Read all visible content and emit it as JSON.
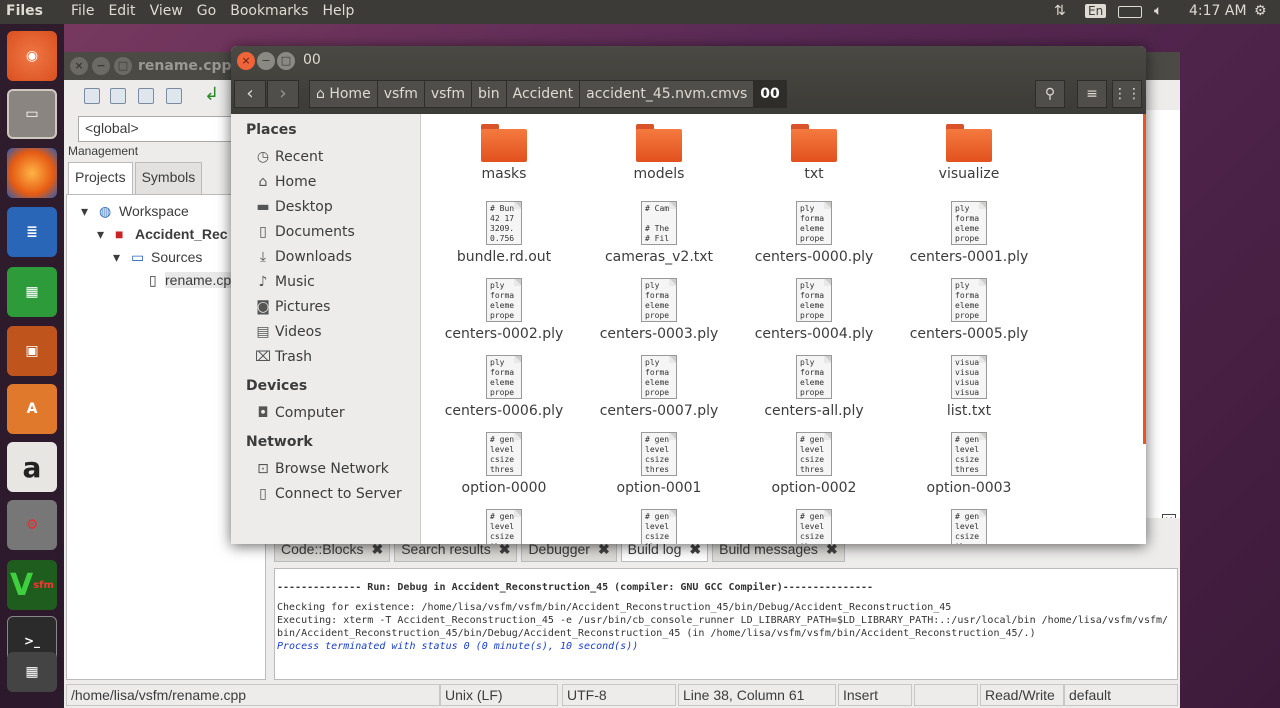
{
  "top_panel": {
    "app_name": "Files",
    "menus": [
      "File",
      "Edit",
      "View",
      "Go",
      "Bookmarks",
      "Help"
    ],
    "keyboard": "En",
    "clock": "4:17 AM"
  },
  "launcher": {
    "items": [
      "ubuntu-dash",
      "files",
      "firefox",
      "writer",
      "calc",
      "impress",
      "software-center",
      "amazon",
      "system-settings",
      "vsfm",
      "terminal",
      "workspace-switcher"
    ],
    "vsfm_label": "sfm"
  },
  "codeblocks": {
    "title": "rename.cpp [",
    "global_combo": "<global>",
    "management_label": "Management",
    "tabs": [
      "Projects",
      "Symbols"
    ],
    "tree": {
      "workspace": "Workspace",
      "project": "Accident_Rec",
      "sources": "Sources",
      "file": "rename.cp"
    },
    "log_tabs": [
      "Code::Blocks",
      "Search results",
      "Debugger",
      "Build log",
      "Build messages"
    ],
    "log_lines": {
      "header": "-------------- Run: Debug in Accident_Reconstruction_45 (compiler: GNU GCC Compiler)---------------",
      "line1": "Checking for existence: /home/lisa/vsfm/vsfm/bin/Accident_Reconstruction_45/bin/Debug/Accident_Reconstruction_45",
      "line2": "Executing: xterm -T Accident_Reconstruction_45 -e /usr/bin/cb_console_runner LD_LIBRARY_PATH=$LD_LIBRARY_PATH:.:/usr/local/bin /home/lisa/vsfm/vsfm/",
      "line3": "bin/Accident_Reconstruction_45/bin/Debug/Accident_Reconstruction_45  (in /home/lisa/vsfm/vsfm/bin/Accident_Reconstruction_45/.)",
      "line4": "Process terminated with status 0 (0 minute(s), 10 second(s))"
    },
    "status": {
      "path": "/home/lisa/vsfm/rename.cpp",
      "eol": "Unix (LF)",
      "encoding": "UTF-8",
      "position": "Line 38, Column 61",
      "mode": "Insert",
      "access": "Read/Write",
      "lang": "default"
    }
  },
  "nautilus": {
    "title": "00",
    "breadcrumbs": [
      "Home",
      "vsfm",
      "vsfm",
      "bin",
      "Accident",
      "accident_45.nvm.cmvs",
      "00"
    ],
    "sidebar": {
      "places_header": "Places",
      "places": [
        {
          "icon": "clock-icon",
          "glyph": "◷",
          "label": "Recent"
        },
        {
          "icon": "home-icon",
          "glyph": "⌂",
          "label": "Home"
        },
        {
          "icon": "folder-icon",
          "glyph": "▬",
          "label": "Desktop"
        },
        {
          "icon": "document-icon",
          "glyph": "▯",
          "label": "Documents"
        },
        {
          "icon": "download-icon",
          "glyph": "⤓",
          "label": "Downloads"
        },
        {
          "icon": "music-icon",
          "glyph": "♪",
          "label": "Music"
        },
        {
          "icon": "camera-icon",
          "glyph": "◙",
          "label": "Pictures"
        },
        {
          "icon": "film-icon",
          "glyph": "▤",
          "label": "Videos"
        },
        {
          "icon": "trash-icon",
          "glyph": "⌧",
          "label": "Trash"
        }
      ],
      "devices_header": "Devices",
      "devices": [
        {
          "icon": "drive-icon",
          "glyph": "◘",
          "label": "Computer"
        }
      ],
      "network_header": "Network",
      "network": [
        {
          "icon": "network-icon",
          "glyph": "⊡",
          "label": "Browse Network"
        },
        {
          "icon": "server-icon",
          "glyph": "▯",
          "label": "Connect to Server"
        }
      ]
    },
    "files": [
      {
        "name": "masks",
        "type": "folder"
      },
      {
        "name": "models",
        "type": "folder"
      },
      {
        "name": "txt",
        "type": "folder"
      },
      {
        "name": "visualize",
        "type": "folder"
      },
      {
        "name": "bundle.rd.out",
        "type": "file",
        "preview": [
          "# Bun",
          "42 17",
          "3209.",
          "0.756"
        ]
      },
      {
        "name": "cameras_v2.txt",
        "type": "file",
        "preview": [
          "# Cam",
          "",
          "# The",
          "# Fil"
        ]
      },
      {
        "name": "centers-0000.ply",
        "type": "file",
        "preview": [
          "ply",
          "forma",
          "eleme",
          "prope"
        ]
      },
      {
        "name": "centers-0001.ply",
        "type": "file",
        "preview": [
          "ply",
          "forma",
          "eleme",
          "prope"
        ]
      },
      {
        "name": "centers-0002.ply",
        "type": "file",
        "preview": [
          "ply",
          "forma",
          "eleme",
          "prope"
        ]
      },
      {
        "name": "centers-0003.ply",
        "type": "file",
        "preview": [
          "ply",
          "forma",
          "eleme",
          "prope"
        ]
      },
      {
        "name": "centers-0004.ply",
        "type": "file",
        "preview": [
          "ply",
          "forma",
          "eleme",
          "prope"
        ]
      },
      {
        "name": "centers-0005.ply",
        "type": "file",
        "preview": [
          "ply",
          "forma",
          "eleme",
          "prope"
        ]
      },
      {
        "name": "centers-0006.ply",
        "type": "file",
        "preview": [
          "ply",
          "forma",
          "eleme",
          "prope"
        ]
      },
      {
        "name": "centers-0007.ply",
        "type": "file",
        "preview": [
          "ply",
          "forma",
          "eleme",
          "prope"
        ]
      },
      {
        "name": "centers-all.ply",
        "type": "file",
        "preview": [
          "ply",
          "forma",
          "eleme",
          "prope"
        ]
      },
      {
        "name": "list.txt",
        "type": "file",
        "preview": [
          "visua",
          "visua",
          "visua",
          "visua"
        ]
      },
      {
        "name": "option-0000",
        "type": "file",
        "preview": [
          "# gen",
          "level",
          "csize",
          "thres"
        ]
      },
      {
        "name": "option-0001",
        "type": "file",
        "preview": [
          "# gen",
          "level",
          "csize",
          "thres"
        ]
      },
      {
        "name": "option-0002",
        "type": "file",
        "preview": [
          "# gen",
          "level",
          "csize",
          "thres"
        ]
      },
      {
        "name": "option-0003",
        "type": "file",
        "preview": [
          "# gen",
          "level",
          "csize",
          "thres"
        ]
      },
      {
        "name": "",
        "type": "file",
        "preview": [
          "# gen",
          "level",
          "csize",
          "thres"
        ]
      },
      {
        "name": "",
        "type": "file",
        "preview": [
          "# gen",
          "level",
          "csize",
          "thres"
        ]
      },
      {
        "name": "",
        "type": "file",
        "preview": [
          "# gen",
          "level",
          "csize",
          "thres"
        ]
      },
      {
        "name": "",
        "type": "file",
        "preview": [
          "# gen",
          "level",
          "csize",
          "thres"
        ]
      }
    ]
  }
}
